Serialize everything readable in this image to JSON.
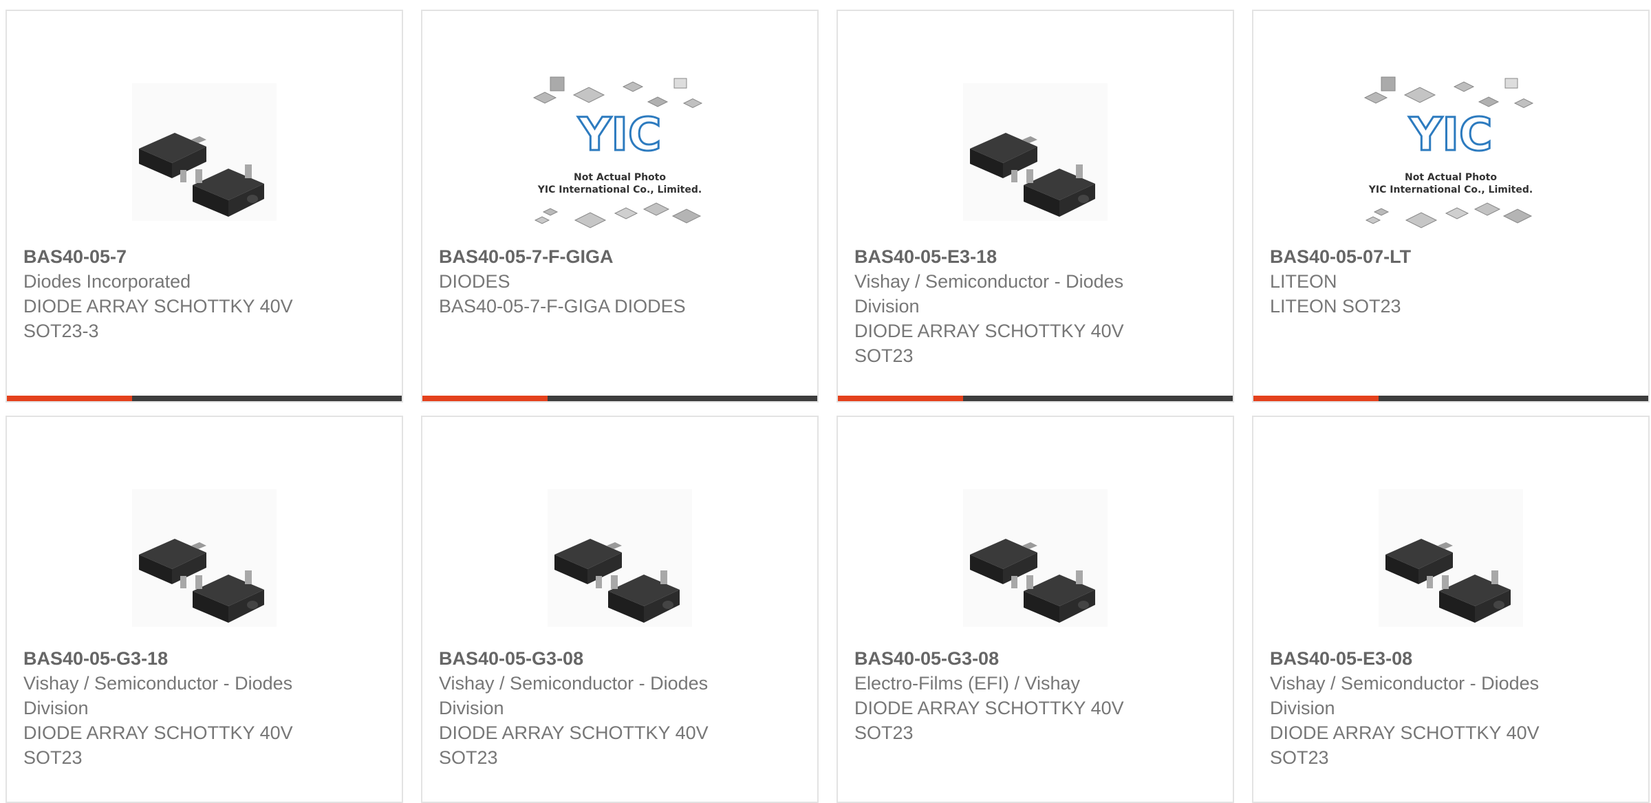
{
  "colors": {
    "accent": "#e4411c",
    "bar": "#3d3d3d",
    "border": "#e3e3e3",
    "text": "#777777"
  },
  "products": [
    {
      "part": "BAS40-05-7",
      "maker": "Diodes Incorporated",
      "desc": "DIODE ARRAY SCHOTTKY 40V SOT23-3",
      "image": "sot23-chip-photo"
    },
    {
      "part": "BAS40-05-7-F-GIGA",
      "maker": "DIODES",
      "desc": "BAS40-05-7-F-GIGA DIODES",
      "image": "yic-placeholder"
    },
    {
      "part": "BAS40-05-E3-18",
      "maker": "Vishay / Semiconductor - Diodes Division",
      "desc": "DIODE ARRAY SCHOTTKY 40V SOT23",
      "image": "sot23-chip-photo"
    },
    {
      "part": "BAS40-05-07-LT",
      "maker": "LITEON",
      "desc": "LITEON SOT23",
      "image": "yic-placeholder"
    },
    {
      "part": "BAS40-05-G3-18",
      "maker": "Vishay / Semiconductor - Diodes Division",
      "desc": "DIODE ARRAY SCHOTTKY 40V SOT23",
      "image": "sot23-chip-photo"
    },
    {
      "part": "BAS40-05-G3-08",
      "maker": "Vishay / Semiconductor - Diodes Division",
      "desc": "DIODE ARRAY SCHOTTKY 40V SOT23",
      "image": "sot23-chip-photo"
    },
    {
      "part": "BAS40-05-G3-08",
      "maker": "Electro-Films (EFI) / Vishay",
      "desc": "DIODE ARRAY SCHOTTKY 40V SOT23",
      "image": "sot23-chip-photo"
    },
    {
      "part": "BAS40-05-E3-08",
      "maker": "Vishay / Semiconductor - Diodes Division",
      "desc": "DIODE ARRAY SCHOTTKY 40V SOT23",
      "image": "sot23-chip-photo"
    }
  ],
  "placeholder": {
    "logo": "YIC",
    "note1": "Not Actual Photo",
    "note2": "YIC International Co., Limited."
  }
}
